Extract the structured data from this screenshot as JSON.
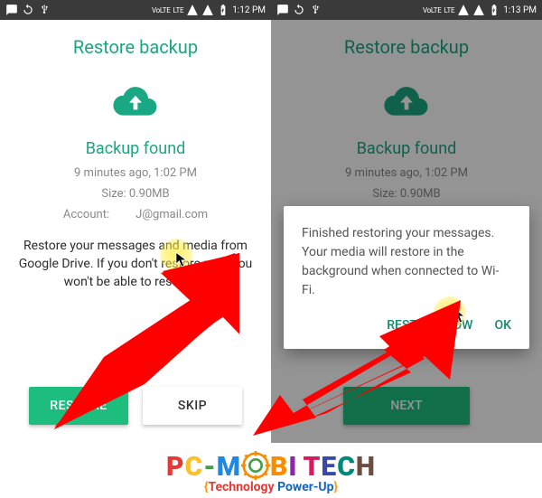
{
  "left": {
    "status": {
      "volte": "VoLTE",
      "lte": "LTE",
      "time": "1:12 PM"
    },
    "title": "Restore backup",
    "subtitle": "Backup found",
    "meta_time": "9 minutes ago, 1:02 PM",
    "meta_size": "Size: 0.90MB",
    "meta_account_label": "Account:",
    "meta_account_value": "J@gmail.com",
    "description": "Restore your messages and media from Google Drive. If you don't restore now, you won't be able to restore la",
    "restore_btn": "RESTORE",
    "skip_btn": "SKIP"
  },
  "right": {
    "status": {
      "volte": "VoLTE",
      "lte": "LTE",
      "time": "1:13 PM"
    },
    "title": "Restore backup",
    "subtitle": "Backup found",
    "meta_time": "9 minutes ago, 1:02 PM",
    "meta_size": "Size: 0.90MB",
    "next_btn": "NEXT",
    "dialog_text": "Finished restoring your messages. Your media will restore in the background when connected to Wi-Fi.",
    "dialog_restore": "RESTORE NOW",
    "dialog_ok": "OK"
  },
  "logo": {
    "line1": "PC-MOBI TECH",
    "line2_open": "{",
    "line2_w1": "Technology",
    "line2_w2": "Power-Up",
    "line2_close": "}"
  },
  "colors": {
    "teal": "#1aa783",
    "green_btn": "#1dbd7d",
    "arrow_red": "#ff0000"
  }
}
